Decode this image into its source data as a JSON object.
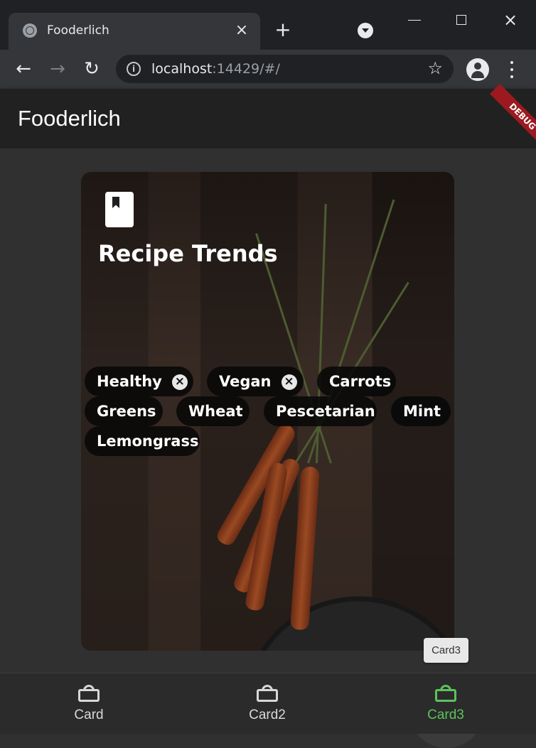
{
  "browser": {
    "tab_title": "Fooderlich",
    "url_host": "localhost",
    "url_rest": ":14429/#/"
  },
  "app": {
    "title": "Fooderlich",
    "debug_banner": "DEBUG",
    "card": {
      "title": "Recipe Trends",
      "chips": [
        {
          "label": "Healthy",
          "removable": true
        },
        {
          "label": "Vegan",
          "removable": true
        },
        {
          "label": "Carrots",
          "removable": false
        },
        {
          "label": "Greens",
          "removable": false
        },
        {
          "label": "Wheat",
          "removable": false
        },
        {
          "label": "Pescetarian",
          "removable": false
        },
        {
          "label": "Mint",
          "removable": false
        },
        {
          "label": "Lemongrass",
          "removable": false
        }
      ]
    },
    "tooltip": "Card3",
    "bottom_nav": [
      {
        "label": "Card",
        "selected": false
      },
      {
        "label": "Card2",
        "selected": false
      },
      {
        "label": "Card3",
        "selected": true
      }
    ],
    "accent_color": "#5cc25c"
  }
}
